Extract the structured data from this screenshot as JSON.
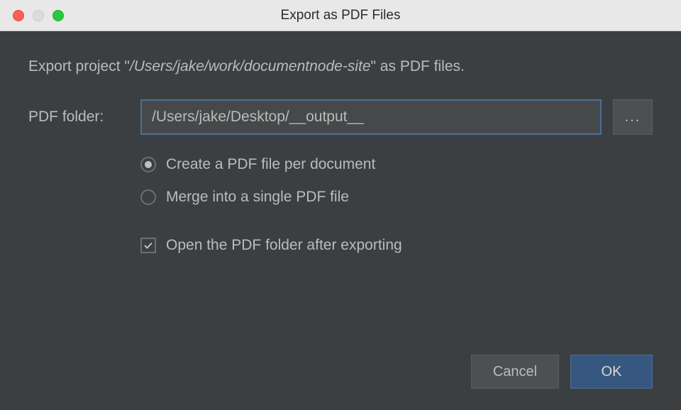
{
  "window": {
    "title": "Export as PDF Files"
  },
  "description": {
    "prefix": "Export project \"",
    "project_path": "/Users/jake/work/documentnode-site",
    "suffix": "\" as PDF files."
  },
  "folder": {
    "label": "PDF folder:",
    "value": "/Users/jake/Desktop/__output__",
    "browse": "..."
  },
  "options": {
    "radio_per_document": "Create a PDF file per document",
    "radio_merge": "Merge into a single PDF file",
    "checkbox_open": "Open the PDF folder after exporting"
  },
  "buttons": {
    "cancel": "Cancel",
    "ok": "OK"
  }
}
